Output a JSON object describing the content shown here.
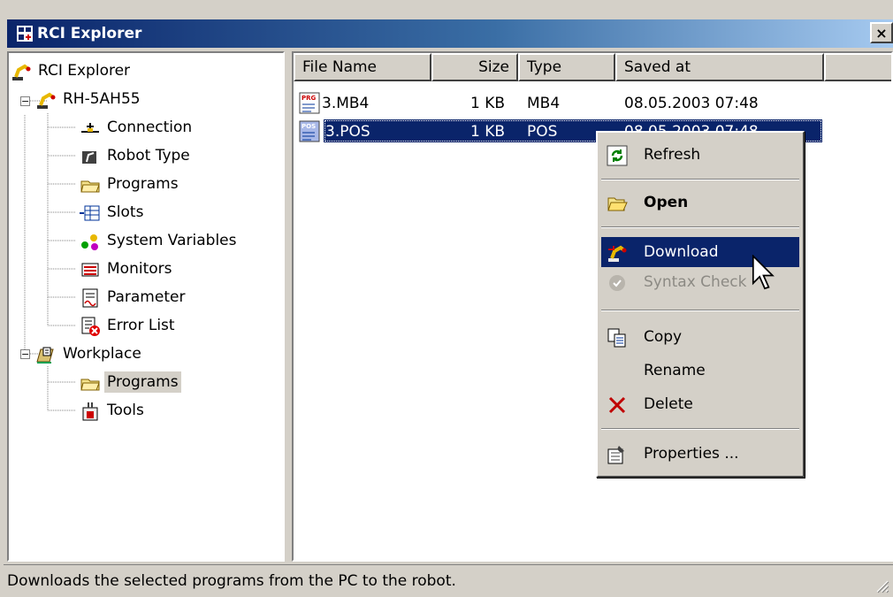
{
  "window": {
    "title": "RCI Explorer",
    "close_label": "×"
  },
  "tree": {
    "root": "RCI Explorer",
    "robot": "RH-5AH55",
    "robot_children": [
      "Connection",
      "Robot Type",
      "Programs",
      "Slots",
      "System Variables",
      "Monitors",
      "Parameter",
      "Error List"
    ],
    "workplace": "Workplace",
    "workplace_children": [
      "Programs",
      "Tools"
    ]
  },
  "list": {
    "columns": [
      "File Name",
      "Size",
      "Type",
      "Saved at"
    ],
    "rows": [
      {
        "name": "3.MB4",
        "size": "1 KB",
        "type": "MB4",
        "saved": "08.05.2003 07:48",
        "icon_text": "PRG"
      },
      {
        "name": "3.POS",
        "size": "1 KB",
        "type": "POS",
        "saved": "08.05.2003 07:48",
        "icon_text": "POS"
      }
    ]
  },
  "context_menu": {
    "items": [
      "Refresh",
      "Open",
      "Download",
      "Syntax Check",
      "Copy",
      "Rename",
      "Delete",
      "Properties ..."
    ]
  },
  "status": {
    "text": "Downloads the selected programs from the PC to the robot."
  },
  "colors": {
    "titlebar": "#0a246a",
    "selection": "#0a246a",
    "face": "#d4d0c8"
  }
}
